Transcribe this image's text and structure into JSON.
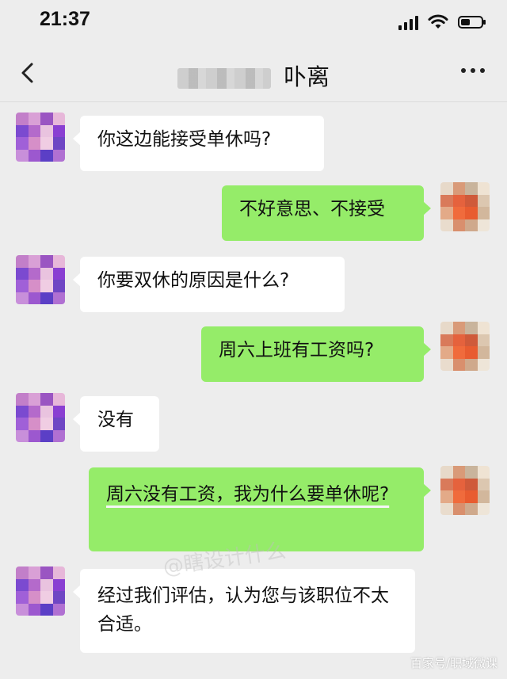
{
  "status_bar": {
    "time": "21:37",
    "icons": [
      "signal-icon",
      "wifi-icon",
      "battery-icon"
    ],
    "battery_level": 0.45
  },
  "header": {
    "title": "卟离",
    "back_icon": "chevron-left-icon",
    "more_icon": "more-dots-icon"
  },
  "messages": [
    {
      "side": "in",
      "text": "你这边能接受单休吗?"
    },
    {
      "side": "out",
      "text": "不好意思、不接受"
    },
    {
      "side": "in",
      "text": "你要双休的原因是什么?"
    },
    {
      "side": "out",
      "text": "周六上班有工资吗?"
    },
    {
      "side": "in",
      "text": "没有"
    },
    {
      "side": "out",
      "text": "周六没有工资，我为什么要单休呢?"
    },
    {
      "side": "in",
      "text": "经过我们评估，认为您与该职位不太合适。"
    }
  ],
  "watermark": "@瞎设计什么",
  "source_mark": "百家号/职域微课",
  "colors": {
    "background": "#ededed",
    "incoming_bubble": "#ffffff",
    "outgoing_bubble": "#95ec69"
  }
}
